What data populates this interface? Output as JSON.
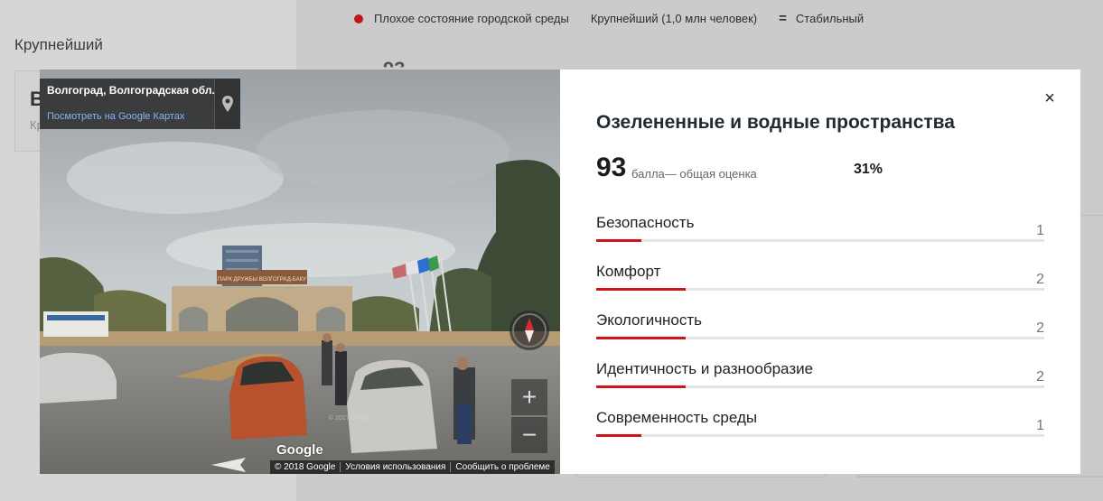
{
  "background": {
    "section_title": "Крупнейший",
    "card_letter": "В",
    "card_sub": "Кр",
    "card_digits": "93"
  },
  "legend": [
    {
      "icon": "red-dot-icon",
      "label": "Плохое состояние городской среды"
    },
    {
      "icon": "",
      "label": "Крупнейший (1,0 млн человек)"
    },
    {
      "icon": "equals-icon",
      "label": "Стабильный"
    }
  ],
  "streetview": {
    "place": "Волгоград, Волгоградская обл.",
    "maps_link": "Посмотреть на Google Картах",
    "sign_text": "ПАРК ДРУЖБЫ ВОЛГОГРАД-БАКУ",
    "logo": "Google",
    "footer": [
      "© 2018 Google",
      "Условия использования",
      "Сообщить о проблеме"
    ],
    "zoom_in": "+",
    "zoom_out": "−",
    "watermark": "© 2017 Google"
  },
  "panel": {
    "close": "×",
    "title": "Озелененные и водные пространства",
    "score": "93",
    "score_caption": "балла— общая оценка",
    "percent": "31%",
    "criteria_max": 10,
    "criteria": [
      {
        "label": "Безопасность",
        "value": "1",
        "fill": 0.1
      },
      {
        "label": "Комфорт",
        "value": "2",
        "fill": 0.2
      },
      {
        "label": "Экологичность",
        "value": "2",
        "fill": 0.2
      },
      {
        "label": "Идентичность и разнообразие",
        "value": "2",
        "fill": 0.2
      },
      {
        "label": "Современность среды",
        "value": "1",
        "fill": 0.1
      }
    ]
  },
  "colors": {
    "accent": "#d0141a",
    "title": "#1f2a33",
    "track": "#e4e4e4"
  }
}
